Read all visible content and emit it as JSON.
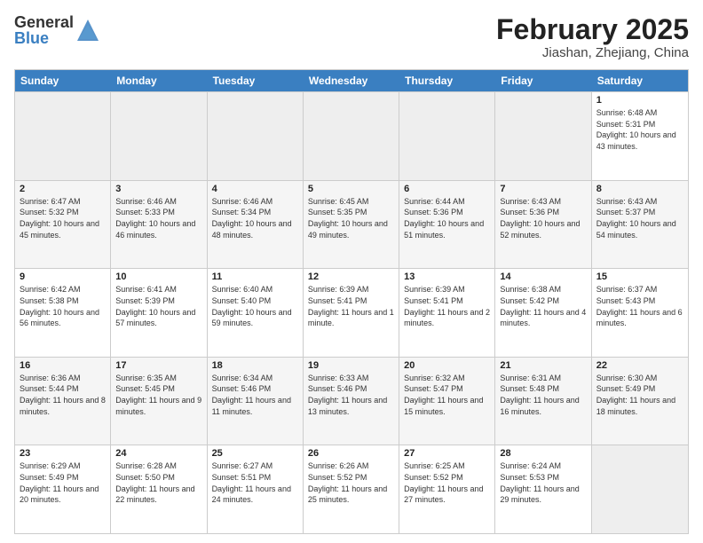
{
  "logo": {
    "general": "General",
    "blue": "Blue"
  },
  "title": "February 2025",
  "location": "Jiashan, Zhejiang, China",
  "days_of_week": [
    "Sunday",
    "Monday",
    "Tuesday",
    "Wednesday",
    "Thursday",
    "Friday",
    "Saturday"
  ],
  "weeks": [
    [
      {
        "day": "",
        "info": ""
      },
      {
        "day": "",
        "info": ""
      },
      {
        "day": "",
        "info": ""
      },
      {
        "day": "",
        "info": ""
      },
      {
        "day": "",
        "info": ""
      },
      {
        "day": "",
        "info": ""
      },
      {
        "day": "1",
        "info": "Sunrise: 6:48 AM\nSunset: 5:31 PM\nDaylight: 10 hours and 43 minutes."
      }
    ],
    [
      {
        "day": "2",
        "info": "Sunrise: 6:47 AM\nSunset: 5:32 PM\nDaylight: 10 hours and 45 minutes."
      },
      {
        "day": "3",
        "info": "Sunrise: 6:46 AM\nSunset: 5:33 PM\nDaylight: 10 hours and 46 minutes."
      },
      {
        "day": "4",
        "info": "Sunrise: 6:46 AM\nSunset: 5:34 PM\nDaylight: 10 hours and 48 minutes."
      },
      {
        "day": "5",
        "info": "Sunrise: 6:45 AM\nSunset: 5:35 PM\nDaylight: 10 hours and 49 minutes."
      },
      {
        "day": "6",
        "info": "Sunrise: 6:44 AM\nSunset: 5:36 PM\nDaylight: 10 hours and 51 minutes."
      },
      {
        "day": "7",
        "info": "Sunrise: 6:43 AM\nSunset: 5:36 PM\nDaylight: 10 hours and 52 minutes."
      },
      {
        "day": "8",
        "info": "Sunrise: 6:43 AM\nSunset: 5:37 PM\nDaylight: 10 hours and 54 minutes."
      }
    ],
    [
      {
        "day": "9",
        "info": "Sunrise: 6:42 AM\nSunset: 5:38 PM\nDaylight: 10 hours and 56 minutes."
      },
      {
        "day": "10",
        "info": "Sunrise: 6:41 AM\nSunset: 5:39 PM\nDaylight: 10 hours and 57 minutes."
      },
      {
        "day": "11",
        "info": "Sunrise: 6:40 AM\nSunset: 5:40 PM\nDaylight: 10 hours and 59 minutes."
      },
      {
        "day": "12",
        "info": "Sunrise: 6:39 AM\nSunset: 5:41 PM\nDaylight: 11 hours and 1 minute."
      },
      {
        "day": "13",
        "info": "Sunrise: 6:39 AM\nSunset: 5:41 PM\nDaylight: 11 hours and 2 minutes."
      },
      {
        "day": "14",
        "info": "Sunrise: 6:38 AM\nSunset: 5:42 PM\nDaylight: 11 hours and 4 minutes."
      },
      {
        "day": "15",
        "info": "Sunrise: 6:37 AM\nSunset: 5:43 PM\nDaylight: 11 hours and 6 minutes."
      }
    ],
    [
      {
        "day": "16",
        "info": "Sunrise: 6:36 AM\nSunset: 5:44 PM\nDaylight: 11 hours and 8 minutes."
      },
      {
        "day": "17",
        "info": "Sunrise: 6:35 AM\nSunset: 5:45 PM\nDaylight: 11 hours and 9 minutes."
      },
      {
        "day": "18",
        "info": "Sunrise: 6:34 AM\nSunset: 5:46 PM\nDaylight: 11 hours and 11 minutes."
      },
      {
        "day": "19",
        "info": "Sunrise: 6:33 AM\nSunset: 5:46 PM\nDaylight: 11 hours and 13 minutes."
      },
      {
        "day": "20",
        "info": "Sunrise: 6:32 AM\nSunset: 5:47 PM\nDaylight: 11 hours and 15 minutes."
      },
      {
        "day": "21",
        "info": "Sunrise: 6:31 AM\nSunset: 5:48 PM\nDaylight: 11 hours and 16 minutes."
      },
      {
        "day": "22",
        "info": "Sunrise: 6:30 AM\nSunset: 5:49 PM\nDaylight: 11 hours and 18 minutes."
      }
    ],
    [
      {
        "day": "23",
        "info": "Sunrise: 6:29 AM\nSunset: 5:49 PM\nDaylight: 11 hours and 20 minutes."
      },
      {
        "day": "24",
        "info": "Sunrise: 6:28 AM\nSunset: 5:50 PM\nDaylight: 11 hours and 22 minutes."
      },
      {
        "day": "25",
        "info": "Sunrise: 6:27 AM\nSunset: 5:51 PM\nDaylight: 11 hours and 24 minutes."
      },
      {
        "day": "26",
        "info": "Sunrise: 6:26 AM\nSunset: 5:52 PM\nDaylight: 11 hours and 25 minutes."
      },
      {
        "day": "27",
        "info": "Sunrise: 6:25 AM\nSunset: 5:52 PM\nDaylight: 11 hours and 27 minutes."
      },
      {
        "day": "28",
        "info": "Sunrise: 6:24 AM\nSunset: 5:53 PM\nDaylight: 11 hours and 29 minutes."
      },
      {
        "day": "",
        "info": ""
      }
    ]
  ]
}
